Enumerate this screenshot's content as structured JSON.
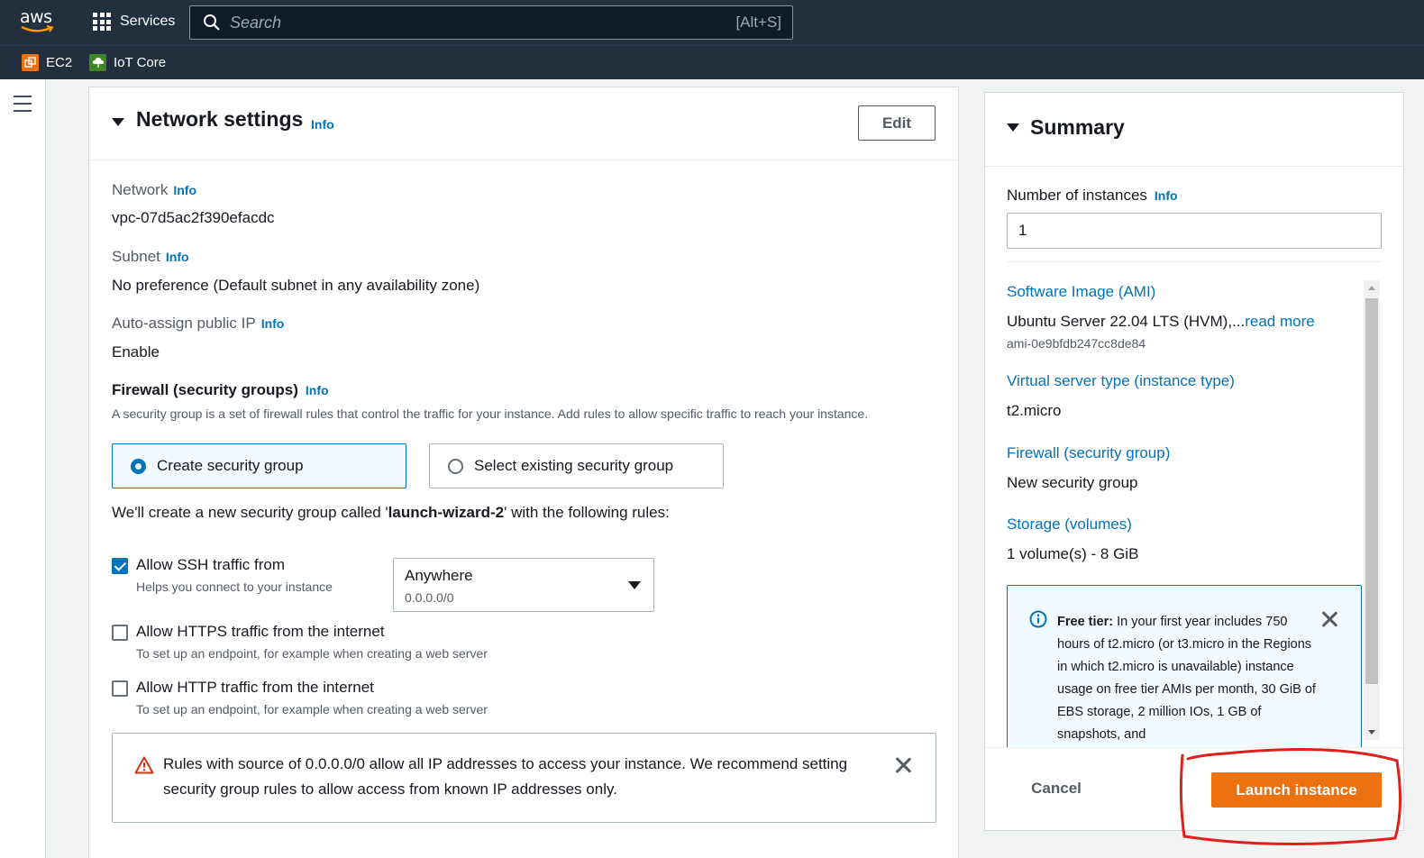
{
  "topnav": {
    "logo": "aws",
    "services_label": "Services",
    "search_placeholder": "Search",
    "search_shortcut": "[Alt+S]",
    "favorites": [
      {
        "label": "EC2",
        "icon": "ec2-icon",
        "color": "#ec7211"
      },
      {
        "label": "IoT Core",
        "icon": "iot-core-icon",
        "color": "#3f8624"
      }
    ]
  },
  "network": {
    "title": "Network settings",
    "info": "Info",
    "edit_label": "Edit",
    "network_label": "Network",
    "network_value": "vpc-07d5ac2f390efacdc",
    "subnet_label": "Subnet",
    "subnet_value": "No preference (Default subnet in any availability zone)",
    "public_ip_label": "Auto-assign public IP",
    "public_ip_value": "Enable",
    "firewall_title": "Firewall (security groups)",
    "firewall_desc": "A security group is a set of firewall rules that control the traffic for your instance. Add rules to allow specific traffic to reach your instance.",
    "create_sg_label": "Create security group",
    "select_sg_label": "Select existing security group",
    "create_note_prefix": "We'll create a new security group called '",
    "sg_name": "launch-wizard-2",
    "create_note_suffix": "' with the following rules:",
    "rules": [
      {
        "label": "Allow SSH traffic from",
        "desc": "Helps you connect to your instance",
        "checked": true
      },
      {
        "label": "Allow HTTPS traffic from the internet",
        "desc": "To set up an endpoint, for example when creating a web server",
        "checked": false
      },
      {
        "label": "Allow HTTP traffic from the internet",
        "desc": "To set up an endpoint, for example when creating a web server",
        "checked": false
      }
    ],
    "ssh_source": {
      "value": "Anywhere",
      "sub": "0.0.0.0/0"
    },
    "warning": "Rules with source of 0.0.0.0/0 allow all IP addresses to access your instance. We recommend setting security group rules to allow access from known IP addresses only."
  },
  "summary": {
    "title": "Summary",
    "instances_label": "Number of instances",
    "info": "Info",
    "instances_value": "1",
    "ami_label": "Software Image (AMI)",
    "ami_value": "Ubuntu Server 22.04 LTS (HVM),...",
    "read_more": "read more",
    "ami_id": "ami-0e9bfdb247cc8de84",
    "instance_type_label": "Virtual server type (instance type)",
    "instance_type_value": "t2.micro",
    "firewall_label": "Firewall (security group)",
    "firewall_value": "New security group",
    "storage_label": "Storage (volumes)",
    "storage_value": "1 volume(s) - 8 GiB",
    "free_tier_bold": "Free tier:",
    "free_tier_text": " In your first year includes 750 hours of t2.micro (or t3.micro in the Regions in which t2.micro is unavailable) instance usage on free tier AMIs per month, 30 GiB of EBS storage, 2 million IOs, 1 GB of snapshots, and",
    "cancel_label": "Cancel",
    "launch_label": "Launch instance"
  },
  "colors": {
    "nav_bg": "#232f3e",
    "link": "#0073bb",
    "primary_button": "#ec7211",
    "annotation": "#e0201b"
  }
}
